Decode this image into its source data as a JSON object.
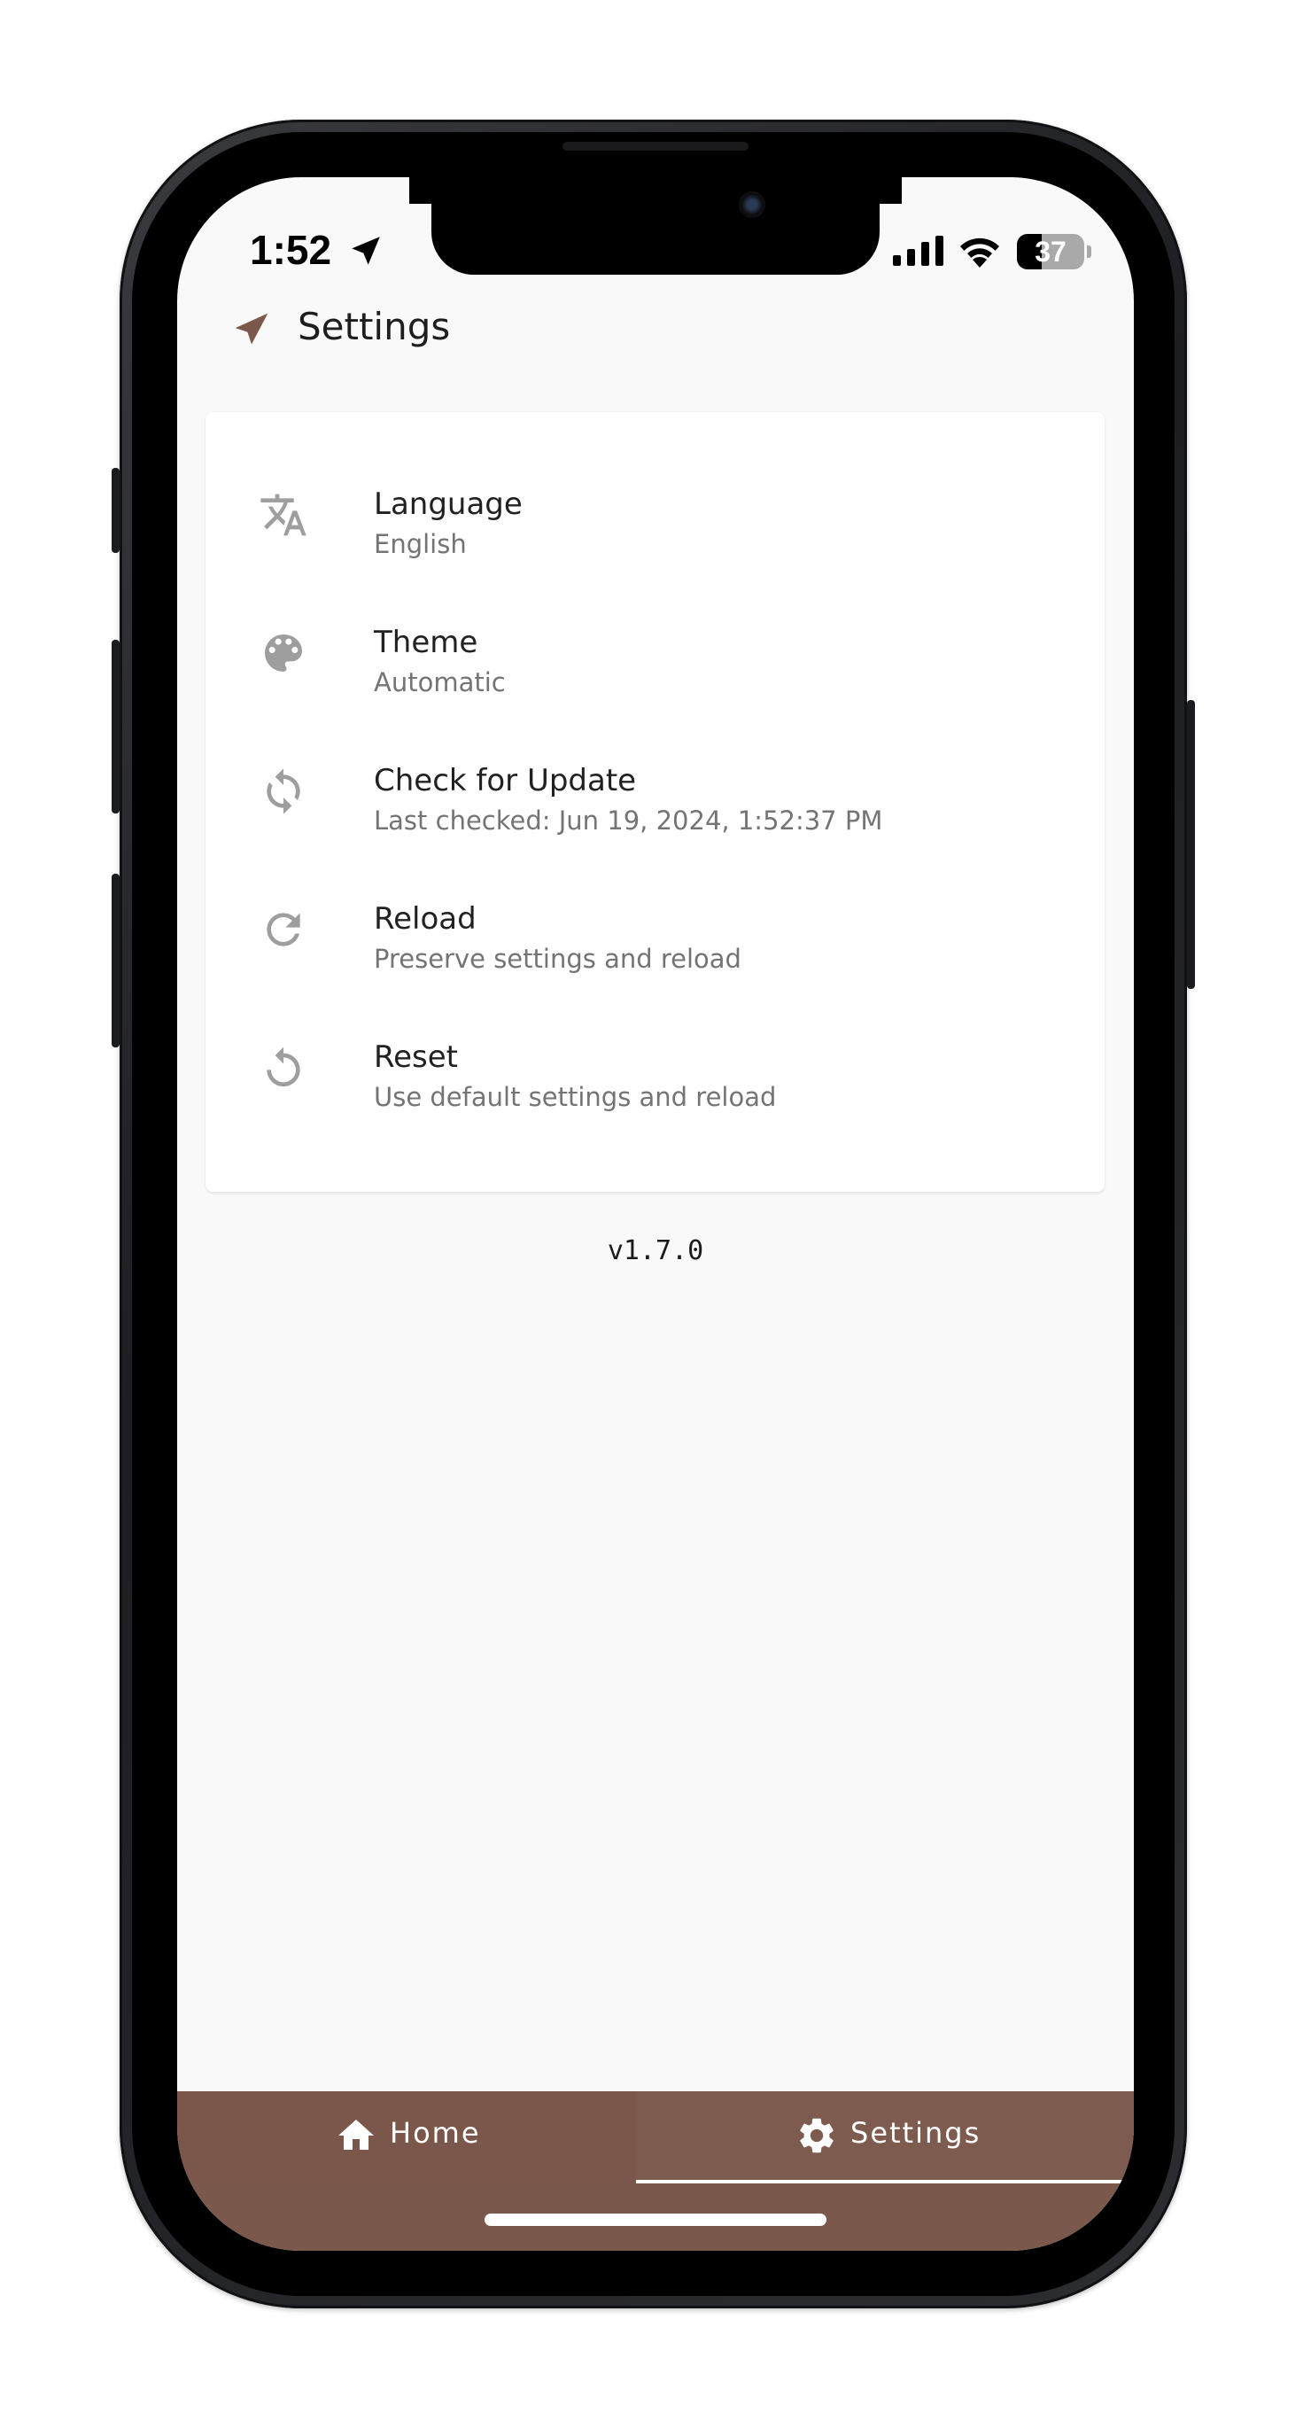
{
  "status_bar": {
    "time": "1:52",
    "battery": "37",
    "battery_level": 0.37
  },
  "header": {
    "title": "Settings",
    "icon": "paper-plane-icon"
  },
  "settings": {
    "items": [
      {
        "icon": "translate-icon",
        "title": "Language",
        "subtitle": "English"
      },
      {
        "icon": "palette-icon",
        "title": "Theme",
        "subtitle": "Automatic"
      },
      {
        "icon": "sync-icon",
        "title": "Check for Update",
        "subtitle": "Last checked: Jun 19, 2024, 1:52:37 PM"
      },
      {
        "icon": "refresh-icon",
        "title": "Reload",
        "subtitle": "Preserve settings and reload"
      },
      {
        "icon": "reset-icon",
        "title": "Reset",
        "subtitle": "Use default settings and reload"
      }
    ]
  },
  "version": "v1.7.0",
  "bottom_nav": {
    "home_label": "Home",
    "settings_label": "Settings",
    "active": "Settings"
  },
  "colors": {
    "accent": "#7b584c",
    "icon_gray": "#9e9e9e",
    "background": "#f9f9f9"
  }
}
